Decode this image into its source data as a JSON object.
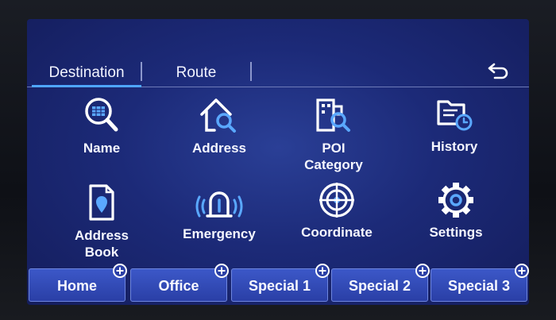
{
  "tabs": {
    "destination": "Destination",
    "route": "Route"
  },
  "menu": {
    "name": "Name",
    "address": "Address",
    "poi_line1": "POI",
    "poi_line2": "Category",
    "history": "History",
    "address_book_line1": "Address",
    "address_book_line2": "Book",
    "emergency": "Emergency",
    "coordinate": "Coordinate",
    "settings": "Settings"
  },
  "favorites": {
    "home": "Home",
    "office": "Office",
    "special1": "Special 1",
    "special2": "Special 2",
    "special3": "Special 3"
  },
  "colors": {
    "accent": "#4fa6ff",
    "screen_bg": "#1c2a78",
    "button_bg": "#2a3fa6"
  },
  "icons": {
    "back": "back-arrow-icon",
    "name": "magnifier-icon",
    "address": "house-magnifier-icon",
    "poi": "building-magnifier-icon",
    "history": "folder-clock-icon",
    "address_book": "contact-card-icon",
    "emergency": "emergency-light-icon",
    "coordinate": "target-icon",
    "settings": "gear-icon",
    "add": "plus-circle-icon"
  }
}
